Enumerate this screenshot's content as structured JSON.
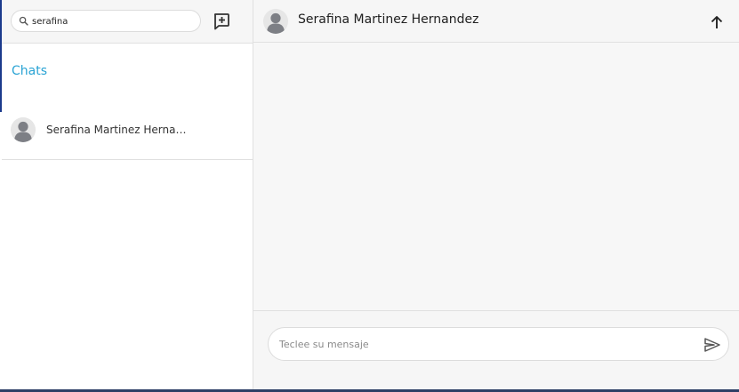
{
  "search": {
    "value": "serafina",
    "icon": "search-icon"
  },
  "left_header": {
    "new_chat_icon": "add-chat-icon"
  },
  "chats": {
    "title": "Chats",
    "items": [
      {
        "name": "Serafina Martinez Hernandez",
        "avatar": "person-avatar"
      }
    ]
  },
  "conversation": {
    "contact_name": "Serafina Martinez Hernandez",
    "avatar": "person-avatar",
    "up_icon": "arrow-up-icon"
  },
  "composer": {
    "placeholder": "Teclee su mensaje",
    "value": "",
    "send_icon": "send-icon"
  },
  "colors": {
    "accent": "#29a3d4",
    "edge": "#1b3a8c",
    "header_bg": "#f6f6f6",
    "panel_bg": "#f7f7f7"
  }
}
